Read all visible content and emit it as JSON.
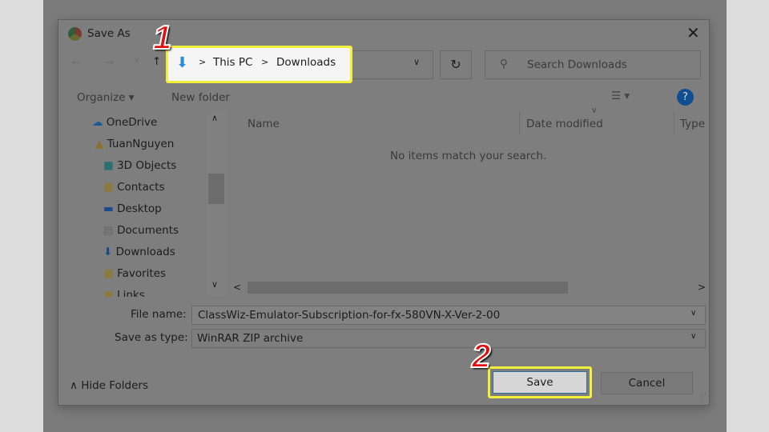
{
  "title": "Save As",
  "breadcrumb": [
    "This PC",
    "Downloads"
  ],
  "search": {
    "placeholder": "Search Downloads"
  },
  "toolbar": {
    "organize": "Organize",
    "new_folder": "New folder",
    "help": "?"
  },
  "sidebar": {
    "items": [
      "OneDrive",
      "TuanNguyen",
      "3D Objects",
      "Contacts",
      "Desktop",
      "Documents",
      "Downloads",
      "Favorites",
      "Links"
    ]
  },
  "columns": [
    "Name",
    "Date modified",
    "Type"
  ],
  "empty_message": "No items match your search.",
  "form": {
    "file_name_label": "File name:",
    "file_name": "ClassWiz-Emulator-Subscription-for-fx-580VN-X-Ver-2-00",
    "type_label": "Save as type:",
    "type": "WinRAR ZIP archive"
  },
  "footer": {
    "hide_folders": "Hide Folders",
    "save": "Save",
    "cancel": "Cancel"
  },
  "annotations": {
    "step1": "1",
    "step2": "2"
  },
  "colors": {
    "highlight": "#f2f03a",
    "step_number": "#e01010",
    "help_icon": "#0f4f8f"
  }
}
